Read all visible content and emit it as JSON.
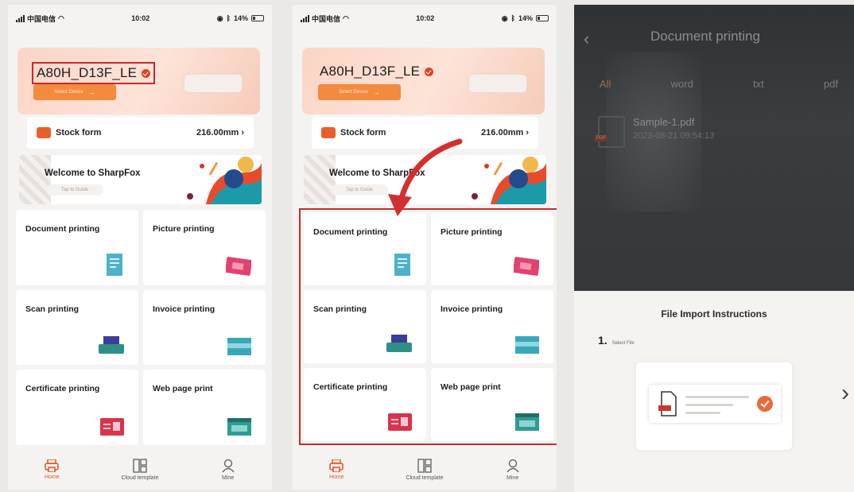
{
  "status": {
    "carrier": "中国电信",
    "time": "10:02",
    "battery": "14%"
  },
  "device": {
    "name": "A80H_D13F_LE",
    "select_label": "Select Device"
  },
  "stock": {
    "label": "Stock form",
    "value": "216.00mm"
  },
  "welcome": {
    "title": "Welcome to SharpFox",
    "guide": "Tap to Guide"
  },
  "functions": [
    {
      "label": "Document printing",
      "icon": "document-icon"
    },
    {
      "label": "Picture printing",
      "icon": "picture-icon"
    },
    {
      "label": "Scan printing",
      "icon": "scanner-icon"
    },
    {
      "label": "Invoice printing",
      "icon": "invoice-icon"
    },
    {
      "label": "Certificate printing",
      "icon": "certificate-icon"
    },
    {
      "label": "Web page print",
      "icon": "webpage-icon"
    }
  ],
  "tabs": [
    {
      "label": "Home",
      "icon": "printer-icon"
    },
    {
      "label": "Cloud template",
      "icon": "template-icon"
    },
    {
      "label": "Mine",
      "icon": "user-icon"
    }
  ],
  "doc_page": {
    "title": "Document printing",
    "tabs": [
      "All",
      "word",
      "txt",
      "pdf"
    ],
    "file_name": "Sample-1.pdf",
    "file_date": "2023-08-21 09:54:13",
    "instructions_title": "File Import Instructions",
    "step_number": "1.",
    "step_text": "Select File"
  },
  "colors": {
    "accent": "#e8552b",
    "highlight_box": "#c62b2b"
  }
}
